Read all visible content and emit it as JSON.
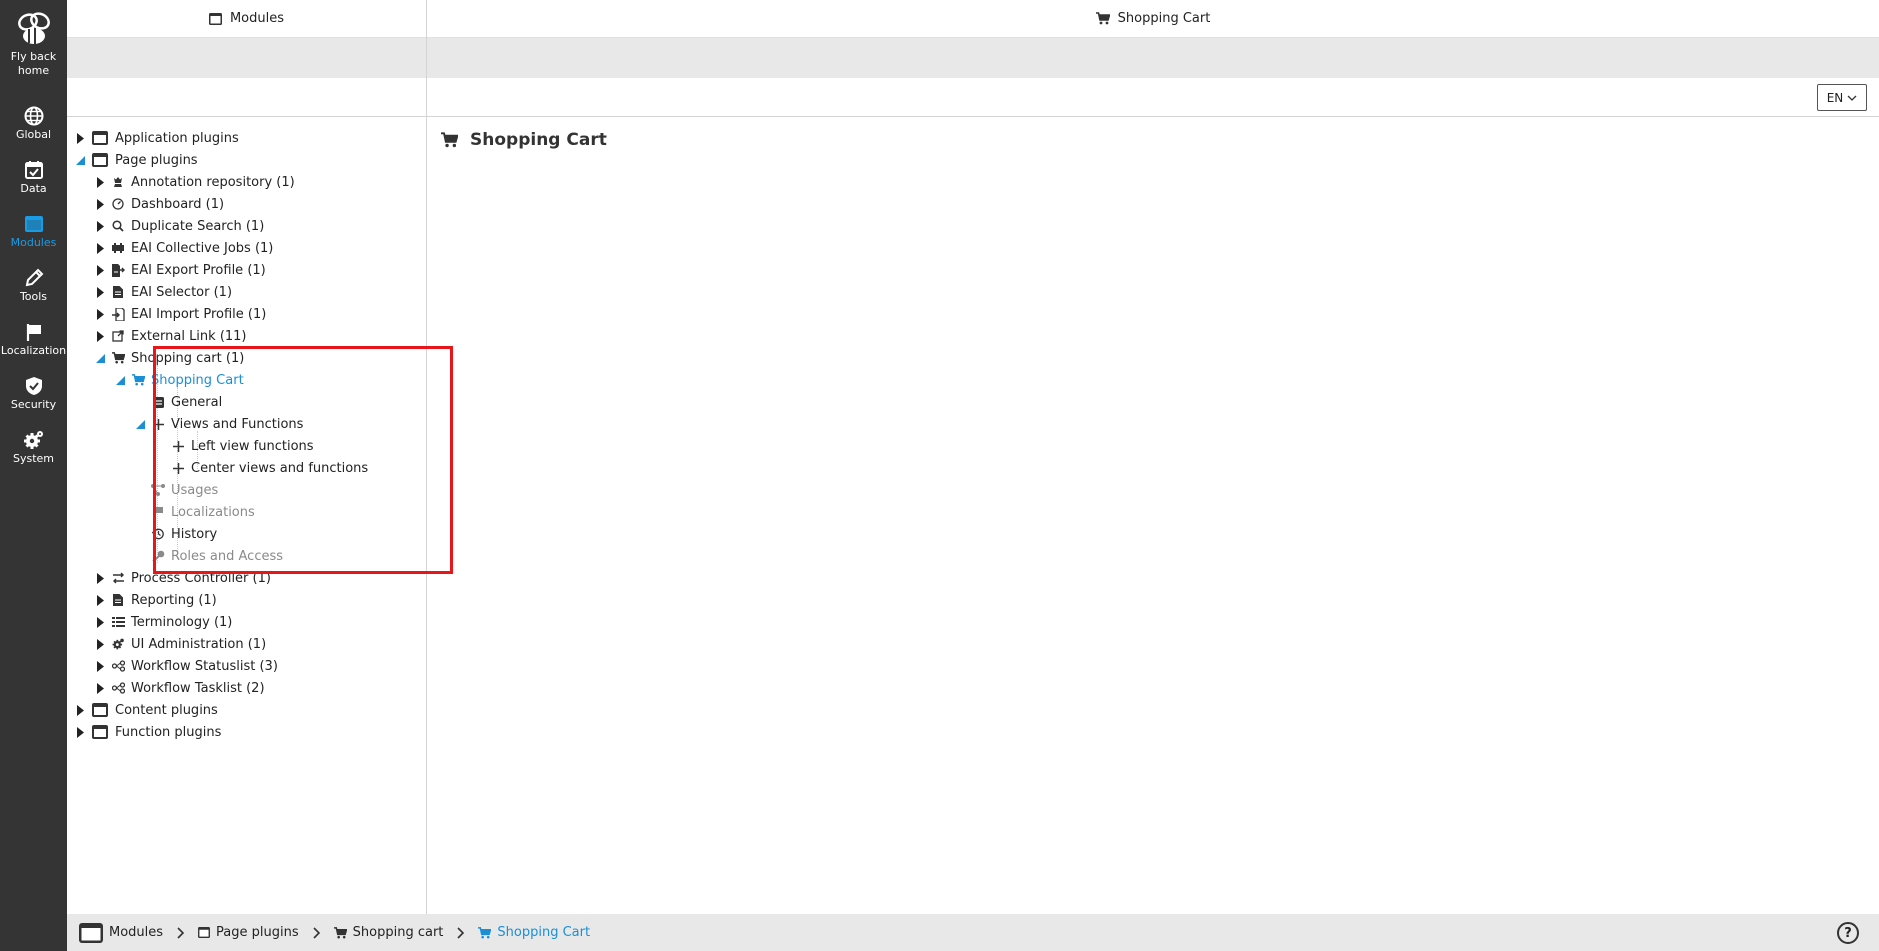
{
  "rail": {
    "items": [
      {
        "label_line1": "Fly back",
        "label_line2": "home",
        "icon": "bee-icon"
      },
      {
        "label": "Global",
        "icon": "globe-icon"
      },
      {
        "label": "Data",
        "icon": "calendar-check-icon"
      },
      {
        "label": "Modules",
        "icon": "window-icon",
        "active": true
      },
      {
        "label": "Tools",
        "icon": "pencil-icon"
      },
      {
        "label": "Localization",
        "icon": "flag-icon"
      },
      {
        "label": "Security",
        "icon": "shield-icon"
      },
      {
        "label": "System",
        "icon": "gears-icon"
      }
    ]
  },
  "left_header": {
    "title": "Modules"
  },
  "right_header": {
    "title": "Shopping Cart"
  },
  "language": {
    "value": "EN"
  },
  "tree": [
    {
      "label": "Application plugins",
      "icon": "window-icon"
    },
    {
      "label": "Page plugins",
      "icon": "window-icon"
    },
    {
      "label": "Annotation repository (1)",
      "icon": "chess-icon"
    },
    {
      "label": "Dashboard (1)",
      "icon": "gauge-icon"
    },
    {
      "label": "Duplicate Search (1)",
      "icon": "search-icon"
    },
    {
      "label": "EAI Collective Jobs (1)",
      "icon": "puzzle-icon"
    },
    {
      "label": "EAI Export Profile (1)",
      "icon": "file-export-icon"
    },
    {
      "label": "EAI Selector (1)",
      "icon": "file-icon"
    },
    {
      "label": "EAI Import Profile (1)",
      "icon": "file-import-icon"
    },
    {
      "label": "External Link (11)",
      "icon": "external-link-icon"
    },
    {
      "label": "Shopping cart (1)",
      "icon": "cart-icon"
    },
    {
      "label": "Shopping Cart",
      "icon": "cart-icon"
    },
    {
      "label": "General",
      "icon": "form-icon"
    },
    {
      "label": "Views and Functions",
      "icon": "plus-icon"
    },
    {
      "label": "Left view functions",
      "icon": "plus-icon"
    },
    {
      "label": "Center views and functions",
      "icon": "plus-icon"
    },
    {
      "label": "Usages",
      "icon": "share-nodes-icon"
    },
    {
      "label": "Localizations",
      "icon": "flag-icon"
    },
    {
      "label": "History",
      "icon": "history-icon"
    },
    {
      "label": "Roles and Access",
      "icon": "key-icon"
    },
    {
      "label": "Process Controller (1)",
      "icon": "process-icon"
    },
    {
      "label": "Reporting (1)",
      "icon": "file-icon"
    },
    {
      "label": "Terminology (1)",
      "icon": "list-icon"
    },
    {
      "label": "UI Administration (1)",
      "icon": "gears-icon"
    },
    {
      "label": "Workflow Statuslist (3)",
      "icon": "workflow-icon"
    },
    {
      "label": "Workflow Tasklist (2)",
      "icon": "workflow-icon"
    },
    {
      "label": "Content plugins",
      "icon": "window-icon"
    },
    {
      "label": "Function plugins",
      "icon": "window-icon"
    }
  ],
  "content": {
    "title": "Shopping Cart"
  },
  "breadcrumb": [
    {
      "label": "Modules"
    },
    {
      "label": "Page plugins"
    },
    {
      "label": "Shopping cart"
    },
    {
      "label": "Shopping Cart"
    }
  ],
  "help": {
    "label": "?"
  },
  "colors": {
    "accent": "#1a8fd6",
    "rail": "#343434",
    "highlight": "#e8161a"
  }
}
